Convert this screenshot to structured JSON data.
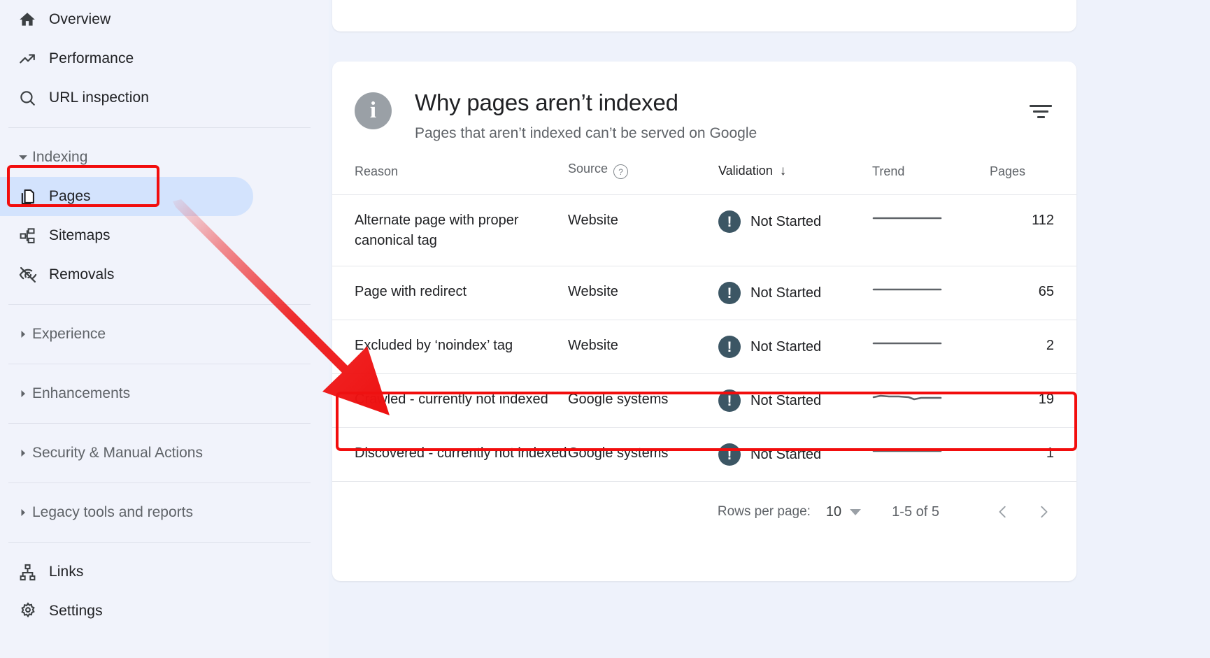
{
  "sidebar": {
    "top_items": [
      {
        "label": "Overview",
        "icon": "home-icon"
      },
      {
        "label": "Performance",
        "icon": "trending-up-icon"
      },
      {
        "label": "URL inspection",
        "icon": "search-icon"
      }
    ],
    "indexing_group": {
      "label": "Indexing",
      "expanded": true,
      "caret": "caret-down-icon"
    },
    "indexing_items": [
      {
        "label": "Pages",
        "icon": "pages-copy-icon",
        "selected": true
      },
      {
        "label": "Sitemaps",
        "icon": "sitemap-icon",
        "selected": false
      },
      {
        "label": "Removals",
        "icon": "eye-off-icon",
        "selected": false
      }
    ],
    "collapsed_groups": [
      {
        "label": "Experience",
        "caret": "caret-right-icon"
      },
      {
        "label": "Enhancements",
        "caret": "caret-right-icon"
      },
      {
        "label": "Security & Manual Actions",
        "caret": "caret-right-icon"
      },
      {
        "label": "Legacy tools and reports",
        "caret": "caret-right-icon"
      }
    ],
    "bottom_items": [
      {
        "label": "Links",
        "icon": "links-icon"
      },
      {
        "label": "Settings",
        "icon": "gear-icon"
      }
    ]
  },
  "card": {
    "info_icon": "info-icon",
    "title": "Why pages aren’t indexed",
    "subtitle": "Pages that aren’t indexed can’t be served on Google",
    "filter_icon": "filter-icon"
  },
  "table": {
    "columns": {
      "reason": "Reason",
      "source": "Source",
      "source_help_icon": "help-icon",
      "validation": "Validation",
      "validation_sort_icon": "sort-descending-arrow",
      "trend": "Trend",
      "pages": "Pages"
    },
    "rows": [
      {
        "reason": "Alternate page with proper canonical tag",
        "source": "Website",
        "validation": "Not Started",
        "status_icon": "exclamation-icon",
        "trend": "flat",
        "pages": "112",
        "highlighted": false
      },
      {
        "reason": "Page with redirect",
        "source": "Website",
        "validation": "Not Started",
        "status_icon": "exclamation-icon",
        "trend": "flat",
        "pages": "65",
        "highlighted": false
      },
      {
        "reason": "Excluded by ‘noindex’ tag",
        "source": "Website",
        "validation": "Not Started",
        "status_icon": "exclamation-icon",
        "trend": "flat",
        "pages": "2",
        "highlighted": false
      },
      {
        "reason": "Crawled - currently not indexed",
        "source": "Google systems",
        "validation": "Not Started",
        "status_icon": "exclamation-icon",
        "trend": "wavy",
        "pages": "19",
        "highlighted": true
      },
      {
        "reason": "Discovered - currently not indexed",
        "source": "Google systems",
        "validation": "Not Started",
        "status_icon": "exclamation-icon",
        "trend": "flat",
        "pages": "1",
        "highlighted": false
      }
    ],
    "footer": {
      "rows_per_page_label": "Rows per page:",
      "rows_per_page_value": "10",
      "dropdown_icon": "caret-down-icon",
      "range": "1-5 of 5",
      "prev_icon": "chevron-left-icon",
      "next_icon": "chevron-right-icon"
    }
  },
  "annotations": {
    "arrow_color": "#ee1111",
    "highlight_box_color": "#f20d0d",
    "selected_nav_pill_color": "#d3e3fd",
    "status_icon_color": "#3c5664"
  }
}
